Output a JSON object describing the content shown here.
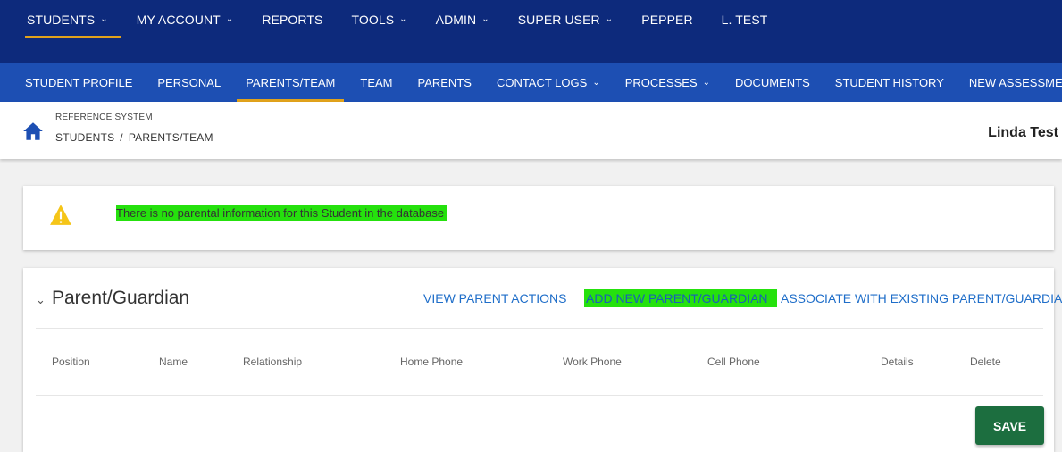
{
  "colors": {
    "top_nav_bg": "#0d2a7c",
    "sub_nav_bg": "#1d4fb3",
    "active_underline": "#e1a21b",
    "highlight_green": "#25e10d",
    "link_blue": "#1f6ec9",
    "save_button": "#1c6e3f",
    "warning_yellow": "#f5c518"
  },
  "top_nav": {
    "items": [
      {
        "label": "STUDENTS",
        "dropdown": true,
        "active": true
      },
      {
        "label": "MY ACCOUNT",
        "dropdown": true
      },
      {
        "label": "REPORTS",
        "dropdown": false
      },
      {
        "label": "TOOLS",
        "dropdown": true
      },
      {
        "label": "ADMIN",
        "dropdown": true
      },
      {
        "label": "SUPER USER",
        "dropdown": true
      },
      {
        "label": "PEPPER",
        "dropdown": false
      },
      {
        "label": "L. TEST",
        "dropdown": false
      }
    ]
  },
  "sub_nav": {
    "items": [
      {
        "label": "STUDENT PROFILE"
      },
      {
        "label": "PERSONAL"
      },
      {
        "label": "PARENTS/TEAM",
        "active": true
      },
      {
        "label": "TEAM"
      },
      {
        "label": "PARENTS"
      },
      {
        "label": "CONTACT LOGS",
        "dropdown": true
      },
      {
        "label": "PROCESSES",
        "dropdown": true
      },
      {
        "label": "DOCUMENTS"
      },
      {
        "label": "STUDENT HISTORY"
      },
      {
        "label": "NEW ASSESSMENTS"
      }
    ]
  },
  "breadcrumb": {
    "system": "REFERENCE SYSTEM",
    "level1": "STUDENTS",
    "separator": "/",
    "level2": "PARENTS/TEAM",
    "icon": "home-icon"
  },
  "user": {
    "name": "Linda Test"
  },
  "alert": {
    "icon": "warning-icon",
    "message": "There is no parental information for this Student in the database"
  },
  "parent_guardian": {
    "title": "Parent/Guardian",
    "toggle_icon": "chevron-down-icon",
    "actions": {
      "view": "VIEW PARENT ACTIONS",
      "add": "ADD NEW PARENT/GUARDIAN",
      "associate": "ASSOCIATE WITH EXISTING PARENT/GUARDIAN"
    },
    "columns": [
      "Position",
      "Name",
      "Relationship",
      "Home Phone",
      "Work Phone",
      "Cell Phone",
      "Details",
      "Delete"
    ],
    "save_label": "SAVE"
  }
}
